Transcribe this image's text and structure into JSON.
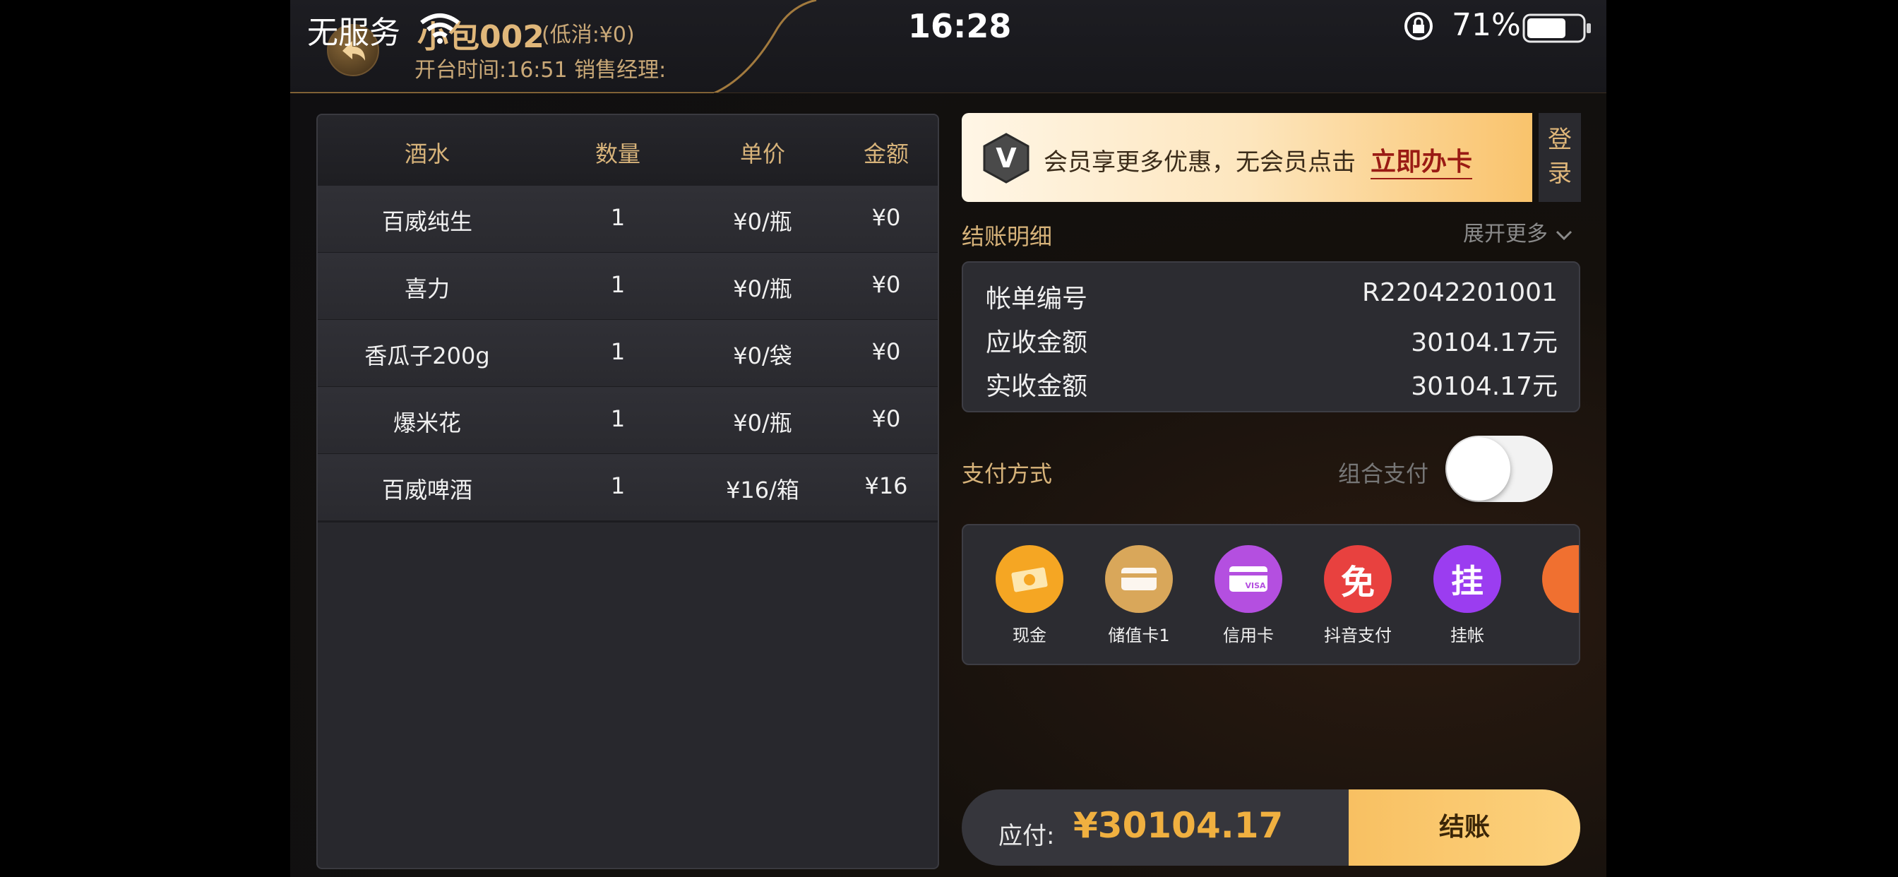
{
  "status_bar": {
    "carrier": "无服务",
    "time": "16:28",
    "battery_percent": "71%",
    "battery_level": 0.71
  },
  "header": {
    "room_name": "小包002",
    "min_spend": "(低消:¥0)",
    "open_time": "开台时间:16:51 销售经理:"
  },
  "order_table": {
    "columns": [
      "酒水",
      "数量",
      "单价",
      "金额"
    ],
    "rows": [
      {
        "name": "百威纯生",
        "qty": "1",
        "unit_price": "¥0/瓶",
        "amount": "¥0"
      },
      {
        "name": "喜力",
        "qty": "1",
        "unit_price": "¥0/瓶",
        "amount": "¥0"
      },
      {
        "name": "香瓜子200g",
        "qty": "1",
        "unit_price": "¥0/袋",
        "amount": "¥0"
      },
      {
        "name": "爆米花",
        "qty": "1",
        "unit_price": "¥0/瓶",
        "amount": "¥0"
      },
      {
        "name": "百威啤酒",
        "qty": "1",
        "unit_price": "¥16/箱",
        "amount": "¥16"
      }
    ]
  },
  "member_banner": {
    "badge": "V",
    "text": "会员享更多优惠，无会员点击",
    "link": "立即办卡",
    "login": "登录"
  },
  "bill": {
    "title": "结账明细",
    "expand": "展开更多",
    "rows": [
      {
        "label": "帐单编号",
        "value": "R22042201001"
      },
      {
        "label": "应收金额",
        "value": "30104.17元"
      },
      {
        "label": "实收金额",
        "value": "30104.17元"
      }
    ]
  },
  "payment": {
    "title": "支付方式",
    "combo_label": "组合支付",
    "combo_enabled": false,
    "methods": [
      {
        "label": "现金",
        "color": "#f5a623",
        "icon": "cash-icon"
      },
      {
        "label": "储值卡1",
        "color": "#d9a75a",
        "icon": "stored-card-icon"
      },
      {
        "label": "信用卡",
        "color": "#b44fe0",
        "icon": "credit-card-icon",
        "glyph": "VISA"
      },
      {
        "label": "抖音支付",
        "color": "#e8413f",
        "icon": "douyin-pay-icon",
        "glyph": "免"
      },
      {
        "label": "挂帐",
        "color": "#9b3df0",
        "icon": "charge-account-icon",
        "glyph": "挂"
      }
    ]
  },
  "footer": {
    "due_label": "应付:",
    "due_amount": "¥30104.17",
    "checkout": "结账"
  },
  "colors": {
    "gold": "#d7b37a",
    "accent_orange": "#f0b040"
  }
}
